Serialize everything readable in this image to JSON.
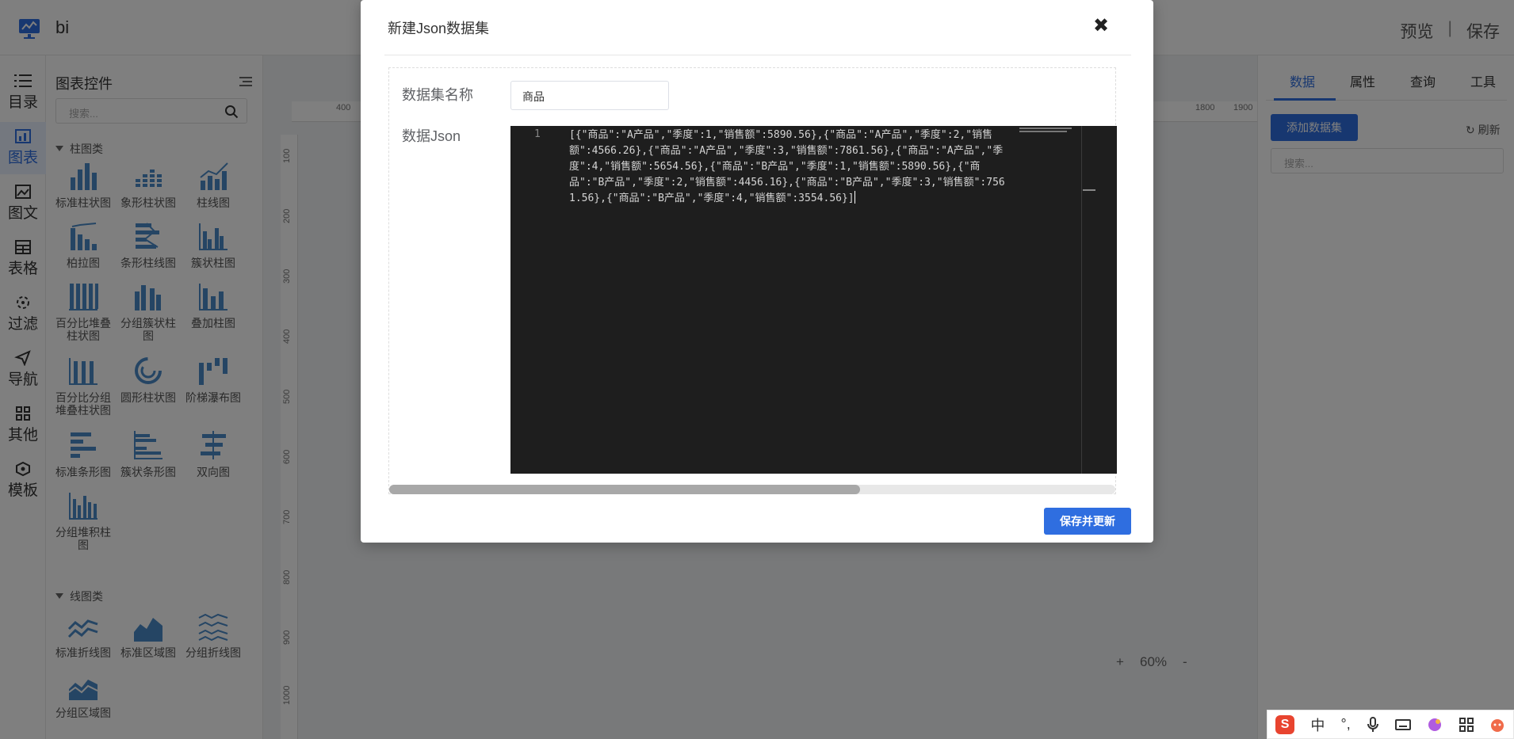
{
  "app": {
    "title": "bi"
  },
  "topbar": {
    "preview": "预览",
    "separator": "|",
    "save": "保存"
  },
  "leftnav": [
    {
      "label": "目录",
      "icon": "list-icon"
    },
    {
      "label": "图表",
      "icon": "chart-icon",
      "active": true
    },
    {
      "label": "图文",
      "icon": "image-text-icon"
    },
    {
      "label": "表格",
      "icon": "table-icon"
    },
    {
      "label": "过滤",
      "icon": "filter-icon"
    },
    {
      "label": "导航",
      "icon": "navigation-icon"
    },
    {
      "label": "其他",
      "icon": "grid-icon"
    },
    {
      "label": "模板",
      "icon": "template-icon"
    }
  ],
  "widget_panel": {
    "title": "图表控件",
    "search_placeholder": "搜索...",
    "categories": [
      {
        "name": "柱图类",
        "items": [
          "标准柱状图",
          "象形柱状图",
          "柱线图",
          "柏拉图",
          "条形柱线图",
          "簇状柱图",
          "百分比堆叠柱状图",
          "分组簇状柱图",
          "叠加柱图",
          "百分比分组堆叠柱状图",
          "圆形柱状图",
          "阶梯瀑布图",
          "标准条形图",
          "簇状条形图",
          "双向图",
          "分组堆积柱图"
        ]
      },
      {
        "name": "线图类",
        "items": [
          "标准折线图",
          "标准区域图",
          "分组折线图",
          "分组区域图"
        ]
      }
    ]
  },
  "canvas": {
    "ruler_top": [
      "400",
      "1800",
      "1900"
    ],
    "ruler_left": [
      "100",
      "200",
      "300",
      "400",
      "500",
      "600",
      "700",
      "800",
      "900",
      "1000"
    ],
    "zoom": {
      "plus": "+",
      "value": "60%",
      "minus": "-"
    }
  },
  "right_panel": {
    "tabs": [
      "数据",
      "属性",
      "查询",
      "工具"
    ],
    "add_dataset": "添加数据集",
    "refresh": "刷新",
    "search_placeholder": "搜索..."
  },
  "modal": {
    "title": "新建Json数据集",
    "name_label": "数据集名称",
    "name_value": "商品",
    "json_label": "数据Json",
    "line_number": "1",
    "json_text": "[{\"商品\":\"A产品\",\"季度\":1,\"销售额\":5890.56},{\"商品\":\"A产品\",\"季度\":2,\"销售额\":4566.26},{\"商品\":\"A产品\",\"季度\":3,\"销售额\":7861.56},{\"商品\":\"A产品\",\"季度\":4,\"销售额\":5654.56},{\"商品\":\"B产品\",\"季度\":1,\"销售额\":5890.56},{\"商品\":\"B产品\",\"季度\":2,\"销售额\":4456.16},{\"商品\":\"B产品\",\"季度\":3,\"销售额\":7561.56},{\"商品\":\"B产品\",\"季度\":4,\"销售额\":3554.56}]",
    "save_button": "保存并更新",
    "close_symbol": "✖"
  },
  "ime": {
    "logo": "S",
    "lang": "中",
    "punct": "°,"
  }
}
